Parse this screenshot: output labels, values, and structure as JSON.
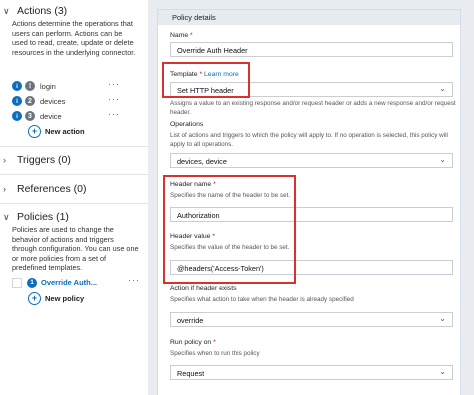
{
  "left": {
    "actions": {
      "title": "Actions (3)",
      "description": "Actions determine the operations that users can perform. Actions can be used to read, create, update or delete resources in the underlying connector.",
      "items": [
        {
          "label": "login",
          "more": "···"
        },
        {
          "label": "devices",
          "more": "···"
        },
        {
          "label": "device",
          "more": "···"
        }
      ],
      "new_label": "New action"
    },
    "triggers": {
      "title": "Triggers (0)"
    },
    "references": {
      "title": "References (0)"
    },
    "policies": {
      "title": "Policies (1)",
      "description": "Policies are used to change the behavior of actions and triggers through configuration. You can use one or more policies from a set of predefined templates.",
      "items": [
        {
          "number": "1",
          "label": "Override Auth...",
          "more": "···"
        }
      ],
      "new_label": "New policy"
    }
  },
  "policy": {
    "panel_title": "Policy details",
    "name": {
      "label": "Name",
      "value": "Override Auth Header"
    },
    "template": {
      "label": "Template",
      "learn_more": "Learn more",
      "value": "Set HTTP header",
      "help": "Assigns a value to an existing response and/or request header or adds a new response and/or request header."
    },
    "operations": {
      "label": "Operations",
      "help": "List of actions and triggers to which the policy will apply to. If no operation is selected, this policy will apply to all operations.",
      "value": "devices, device"
    },
    "header_name": {
      "label": "Header name",
      "help": "Specifies the name of the header to be set.",
      "value": "Authorization"
    },
    "header_value": {
      "label": "Header value",
      "help": "Specifies the value of the header to be set.",
      "value": "@headers('Access-Token')"
    },
    "action_if_exists": {
      "label": "Action if header exists",
      "help": "Specifies what action to take when the header is already specified",
      "value": "override"
    },
    "run_on": {
      "label": "Run policy on",
      "help": "Specifies when to run this policy",
      "value": "Request"
    }
  },
  "icons": {
    "chevron_expanded": "chevron-down-icon",
    "chevron_collapsed": "chevron-right-icon",
    "info": "info-icon",
    "plus": "plus-circle-icon",
    "dropdown": "chevron-down-icon"
  },
  "colors": {
    "accent": "#0a6ebd",
    "highlight": "#d93030",
    "badge_gray": "#6b7380",
    "panel_bg": "#e9edf2"
  }
}
